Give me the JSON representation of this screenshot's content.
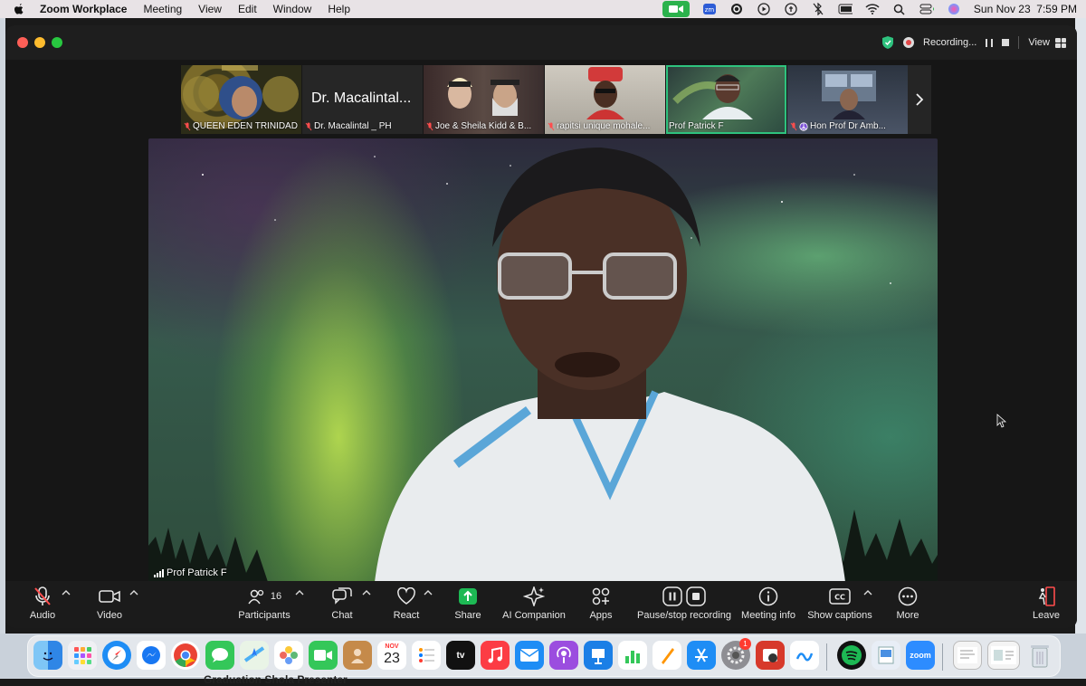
{
  "menubar": {
    "app_name": "Zoom Workplace",
    "menus": [
      "Meeting",
      "View",
      "Edit",
      "Window",
      "Help"
    ],
    "datetime": "Sun Nov 23  7:59 PM"
  },
  "window": {
    "recording_label": "Recording...",
    "view_label": "View"
  },
  "thumbnails": [
    {
      "name": "QUEEN EDEN TRINIDAD",
      "muted": true
    },
    {
      "name": "Dr. Macalintal _ PH",
      "big_name": "Dr. Macalintal...",
      "muted": true
    },
    {
      "name": "Joe & Sheila Kidd & B...",
      "muted": true
    },
    {
      "name": "rapitsi unique mohale...",
      "muted": true
    },
    {
      "name": "Prof Patrick F",
      "muted": false,
      "active": true
    },
    {
      "name": "Hon Prof Dr Amb...",
      "muted": true
    }
  ],
  "main_speaker": {
    "name": "Prof Patrick F"
  },
  "toolbar": {
    "audio": "Audio",
    "video": "Video",
    "participants": "Participants",
    "participants_count": "16",
    "chat": "Chat",
    "react": "React",
    "share": "Share",
    "ai_companion": "AI Companion",
    "apps": "Apps",
    "recording": "Pause/stop recording",
    "meeting_info": "Meeting info",
    "captions": "Show captions",
    "more": "More",
    "leave": "Leave"
  },
  "dock": {
    "calendar_month": "NOV",
    "calendar_day": "23",
    "settings_badge": "1",
    "zoom_label": "zoom"
  },
  "desktop_text": "Graduation Shola Presenter"
}
